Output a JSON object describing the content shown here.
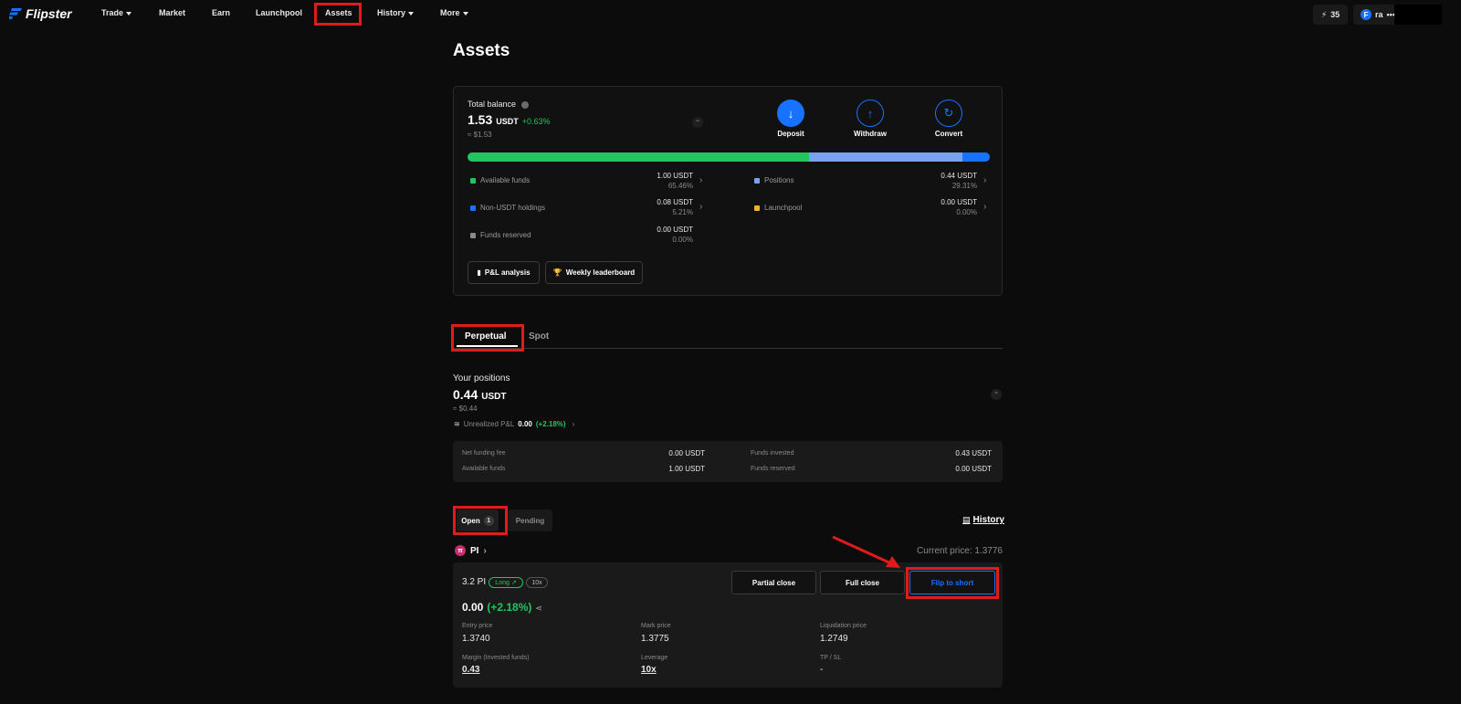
{
  "app": {
    "name": "Flipster"
  },
  "nav": {
    "trade": "Trade",
    "market": "Market",
    "earn": "Earn",
    "launchpool": "Launchpool",
    "assets": "Assets",
    "history": "History",
    "more": "More"
  },
  "topbar": {
    "points": "35",
    "user": "ra",
    "menu_dots": "•••"
  },
  "page": {
    "title": "Assets"
  },
  "balance": {
    "label": "Total balance",
    "amount": "1.53",
    "unit": "USDT",
    "change": "+0.63%",
    "approx": "≈ $1.53",
    "actions": {
      "deposit": "Deposit",
      "withdraw": "Withdraw",
      "convert": "Convert"
    },
    "breakdown_bar": [
      {
        "name": "Available funds",
        "share": 65.46,
        "color": "#22c55e"
      },
      {
        "name": "Positions",
        "share": 29.31,
        "color": "#7aa0f0"
      },
      {
        "name": "Non-USDT holdings",
        "share": 5.21,
        "color": "#1773ff"
      }
    ],
    "rows": {
      "available_funds": {
        "label": "Available funds",
        "value": "1.00 USDT",
        "pct": "65.46%",
        "color": "#22c55e"
      },
      "non_usdt": {
        "label": "Non-USDT holdings",
        "value": "0.08 USDT",
        "pct": "5.21%",
        "color": "#1773ff"
      },
      "funds_reserved": {
        "label": "Funds reserved",
        "value": "0.00 USDT",
        "pct": "0.00%",
        "color": "#8a8a8a"
      },
      "positions": {
        "label": "Positions",
        "value": "0.44 USDT",
        "pct": "29.31%",
        "color": "#7aa0f0"
      },
      "launchpool": {
        "label": "Launchpool",
        "value": "0.00 USDT",
        "pct": "0.00%",
        "color": "#f0b030"
      }
    },
    "buttons": {
      "pnl": "P&L analysis",
      "leaderboard": "Weekly leaderboard"
    }
  },
  "tabs": {
    "perpetual": "Perpetual",
    "spot": "Spot"
  },
  "positions": {
    "label": "Your positions",
    "amount": "0.44",
    "unit": "USDT",
    "approx": "≈ $0.44",
    "unrealized_label": "Unrealized P&L",
    "unrealized_value": "0.00",
    "unrealized_pct": "(+2.18%)",
    "summary": {
      "net_funding_fee_label": "Net funding fee",
      "net_funding_fee": "0.00 USDT",
      "available_funds_label": "Available funds",
      "available_funds": "1.00 USDT",
      "funds_invested_label": "Funds invested",
      "funds_invested": "0.43 USDT",
      "funds_reserved_label": "Funds reserved",
      "funds_reserved": "0.00 USDT"
    }
  },
  "order_tabs": {
    "open": "Open",
    "open_count": "1",
    "pending": "Pending",
    "history": "History"
  },
  "position": {
    "symbol": "PI",
    "current_price_label": "Current price: 1.3776",
    "size": "3.2 PI",
    "side": "Long ↗",
    "leverage_pill": "10x",
    "buttons": {
      "partial_close": "Partial close",
      "full_close": "Full close",
      "flip": "Flip to short"
    },
    "pnl_value": "0.00",
    "pnl_pct": "(+2.18%)",
    "entry_price_label": "Entry price",
    "entry_price": "1.3740",
    "mark_price_label": "Mark price",
    "mark_price": "1.3775",
    "liq_price_label": "Liquidation price",
    "liq_price": "1.2749",
    "margin_label": "Margin (Invested funds)",
    "margin": "0.43",
    "leverage_label": "Leverage",
    "leverage": "10x",
    "tpsl_label": "TP / SL",
    "tpsl": "-"
  },
  "colors": {
    "accent": "#1773ff",
    "positive": "#22c55e",
    "highlight": "#e01b1b"
  }
}
